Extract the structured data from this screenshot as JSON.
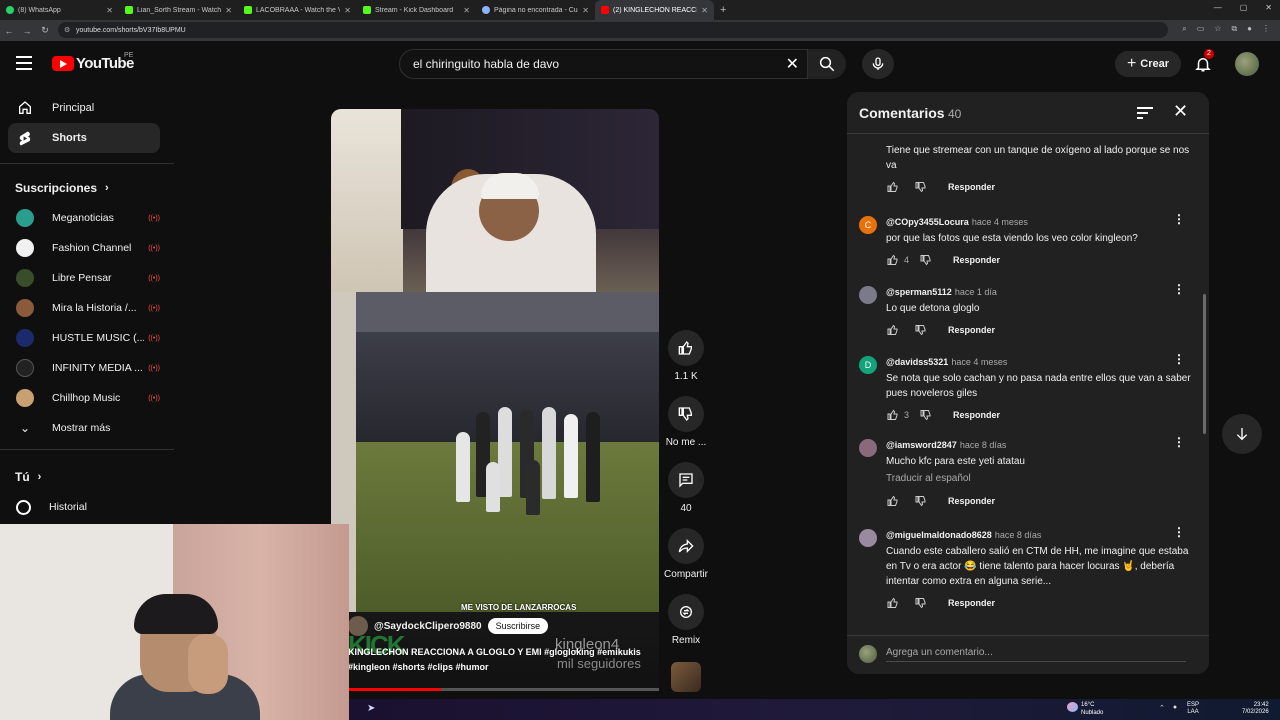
{
  "browser": {
    "tabs": [
      {
        "title": "(8) WhatsApp",
        "color": "#25d366"
      },
      {
        "title": "Lian_Sorth Stream - Watch Live",
        "color": "#53fc18"
      },
      {
        "title": "LACOBRAAA - Watch the Video",
        "color": "#53fc18"
      },
      {
        "title": "Stream - Kick Dashboard",
        "color": "#53fc18"
      },
      {
        "title": "Página no encontrada - Cuevana",
        "color": "#8ab4f8"
      },
      {
        "title": "(2) KINGLECHON REACCIONA",
        "color": "#ff0000"
      }
    ],
    "url": "youtube.com/shorts/bV37Ib8UPMU"
  },
  "header": {
    "logo_text": "YouTube",
    "region": "PE",
    "search_query": "el chiringuito habla de davo",
    "create_label": "Crear",
    "notif_count": "2"
  },
  "sidebar": {
    "items": [
      {
        "label": "Principal",
        "icon": "home-icon"
      },
      {
        "label": "Shorts",
        "icon": "shorts-icon"
      }
    ],
    "subs_heading": "Suscripciones",
    "subscriptions": [
      {
        "name": "Meganoticias",
        "color": "#2a9d8f"
      },
      {
        "name": "Fashion Channel",
        "color": "#f1f1f1"
      },
      {
        "name": "Libre Pensar",
        "color": "#3a4d2a"
      },
      {
        "name": "Mira la Historia /...",
        "color": "#8a5a3a"
      },
      {
        "name": "HUSTLE MUSIC (...",
        "color": "#1a2a6a"
      },
      {
        "name": "INFINITY MEDIA ...",
        "color": "#222222"
      },
      {
        "name": "Chillhop Music",
        "color": "#c9a070"
      }
    ],
    "more_label": "Mostrar más",
    "you_heading": "Tú",
    "history_label": "Historial"
  },
  "video": {
    "overlay_text": "ME VISTO DE LANZARROCAS",
    "channel": "@SaydockClipero9880",
    "subscribe_label": "Suscribirse",
    "title": "KINGLECHON REACCIONA A GLOGLO Y EMI #glogloking #emikukis #kingleon #shorts #clips #humor",
    "background_text_1": "kingleon4",
    "background_text_2": "mil seguidores",
    "progress": 0.3
  },
  "actions": {
    "like": "1.1 K",
    "dislike": "No me ...",
    "comments": "40",
    "share": "Compartir",
    "remix": "Remix"
  },
  "comments": {
    "title": "Comentarios",
    "count": "40",
    "list": [
      {
        "author": "",
        "time": "",
        "text": "Tiene que stremear con un tanque de oxígeno al lado porque se nos va",
        "likes": "",
        "avatar": "#555555",
        "initial": ""
      },
      {
        "author": "@COpy3455Locura",
        "time": "hace 4 meses",
        "text": "por que las fotos que esta viendo los veo color kingleon?",
        "likes": "4",
        "avatar": "#e8710a",
        "initial": "C"
      },
      {
        "author": "@sperman5112",
        "time": "hace 1 día",
        "text": "Lo que detona gloglo",
        "likes": "",
        "avatar": "#7a7a8a",
        "initial": ""
      },
      {
        "author": "@davidss5321",
        "time": "hace 4 meses",
        "text": "Se nota que solo cachan y no pasa nada entre ellos que van a saber pues noveleros giles",
        "likes": "3",
        "avatar": "#12a37a",
        "initial": "D"
      },
      {
        "author": "@iamsword2847",
        "time": "hace 8 días",
        "text": "Mucho kfc para este yeti atatau",
        "likes": "",
        "avatar": "#8a6a7a",
        "initial": "",
        "translate": "Traducir al español"
      },
      {
        "author": "@miguelmaldonado8628",
        "time": "hace 8 días",
        "text": "Cuando este caballero salió en CTM de HH, me imagine que estaba en Tv o era actor 😂 tiene talento para hacer locuras 🤘, debería intentar como extra en alguna serie...",
        "likes": "",
        "avatar": "#9a8aa0",
        "initial": ""
      }
    ],
    "reply_label": "Responder",
    "add_placeholder": "Agrega un comentario..."
  },
  "taskbar": {
    "temp": "16°C",
    "weather": "Nublado",
    "lang_1": "ESP",
    "lang_2": "LAA",
    "time": "23:42",
    "date": "7/02/2026"
  }
}
